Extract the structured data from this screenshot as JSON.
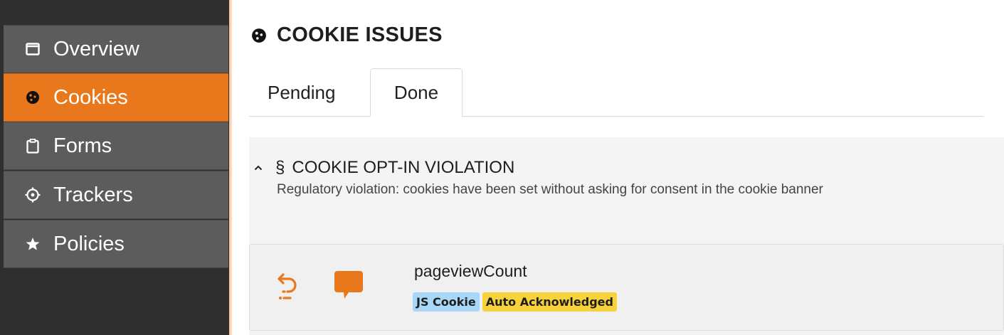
{
  "sidebar": {
    "items": [
      {
        "label": "Overview",
        "icon": "window-icon",
        "active": false
      },
      {
        "label": "Cookies",
        "icon": "cookie-icon",
        "active": true
      },
      {
        "label": "Forms",
        "icon": "clipboard-icon",
        "active": false
      },
      {
        "label": "Trackers",
        "icon": "target-icon",
        "active": false
      },
      {
        "label": "Policies",
        "icon": "star-icon",
        "active": false
      }
    ]
  },
  "header": {
    "title": "COOKIE ISSUES",
    "icon": "cookie-icon"
  },
  "tabs": [
    {
      "label": "Pending",
      "active": false
    },
    {
      "label": "Done",
      "active": true
    }
  ],
  "violation": {
    "section_symbol": "§",
    "title": "COOKIE OPT-IN VIOLATION",
    "description": "Regulatory violation: cookies have been set without asking for consent in the cookie banner"
  },
  "cookie": {
    "name": "pageviewCount",
    "badges": [
      {
        "label": "JS Cookie",
        "color": "#a9d7f7"
      },
      {
        "label": "Auto Acknowledged",
        "color": "#f7d23b"
      }
    ]
  },
  "colors": {
    "accent": "#e8781b",
    "sidebar_bg": "#2f2f2f",
    "sidebar_item": "#5c5c5c"
  }
}
